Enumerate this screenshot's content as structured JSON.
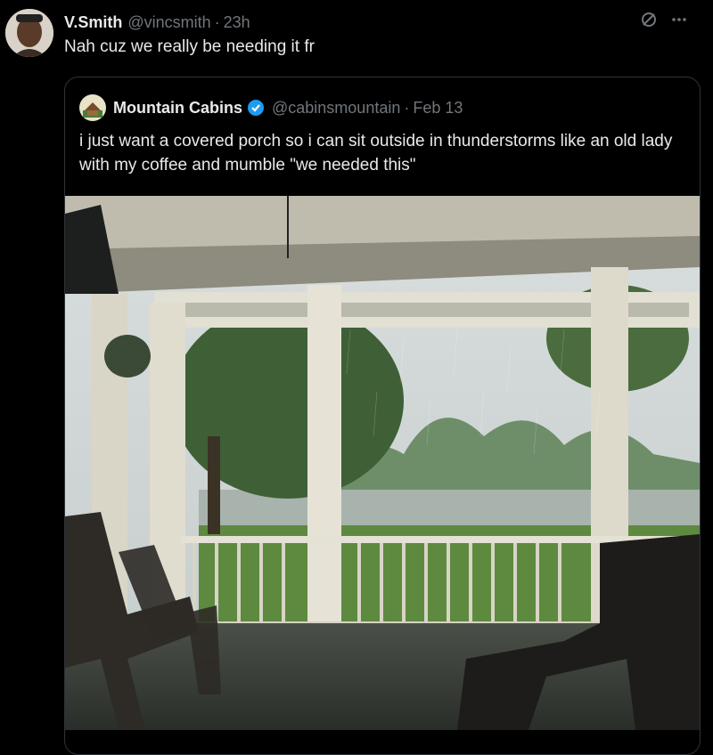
{
  "tweet": {
    "author_name": "V.Smith",
    "author_handle": "@vincsmith",
    "separator": "·",
    "time": "23h",
    "text": "Nah cuz we really be needing it fr",
    "icons": [
      "grok-icon",
      "more-icon"
    ]
  },
  "quoted": {
    "author_name": "Mountain Cabins",
    "author_handle": "@cabinsmountain",
    "separator": "·",
    "date": "Feb 13",
    "text": "i just want a covered porch so i can sit outside in thunderstorms like an old lady with my coffee and mumble \"we needed this\"",
    "verified_color": "#1d9bf0"
  },
  "colors": {
    "background": "#000000",
    "text": "#e7e9ea",
    "muted": "#71767b",
    "border": "#2f3336"
  }
}
